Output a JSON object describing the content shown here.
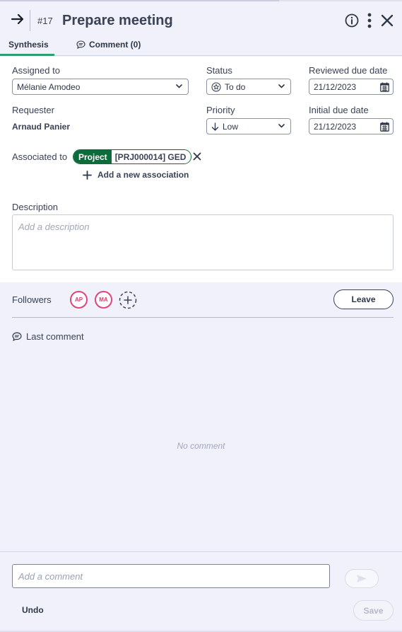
{
  "header": {
    "task_id": "#17",
    "title": "Prepare meeting",
    "icons": [
      "arrow-right-icon",
      "info-icon",
      "kebab-icon",
      "close-icon"
    ]
  },
  "tabs": [
    {
      "label": "Synthesis",
      "active": true
    },
    {
      "label": "Comment (0)",
      "active": false,
      "icon": "comment-icon"
    }
  ],
  "fields": {
    "assigned_to": {
      "label": "Assigned to",
      "value": "Mélanie Amodeo"
    },
    "status": {
      "label": "Status",
      "value": "To do",
      "icon": "star-circle-icon"
    },
    "reviewed_due_date": {
      "label": "Reviewed due date",
      "value": "21/12/2023"
    },
    "requester": {
      "label": "Requester",
      "value": "Arnaud Panier"
    },
    "priority": {
      "label": "Priority",
      "value": "Low",
      "icon": "arrow-down-icon"
    },
    "initial_due_date": {
      "label": "Initial due date",
      "value": "21/12/2023"
    }
  },
  "association": {
    "label": "Associated to",
    "chip_type": "Project",
    "chip_name": "[PRJ000014] GED",
    "add_label": "Add a new association"
  },
  "description": {
    "label": "Description",
    "placeholder": "Add a description"
  },
  "followers": {
    "label": "Followers",
    "avatars": [
      "AP",
      "MA"
    ],
    "leave_label": "Leave"
  },
  "comments": {
    "last_comment_label": "Last comment",
    "empty_text": "No comment",
    "input_placeholder": "Add a comment"
  },
  "footer": {
    "undo_label": "Undo",
    "save_label": "Save"
  },
  "colors": {
    "accent": "#2c9f6c",
    "chip": "#0b6b3a",
    "avatar": "#e0457b",
    "panel_bg": "#f0f1fa"
  }
}
